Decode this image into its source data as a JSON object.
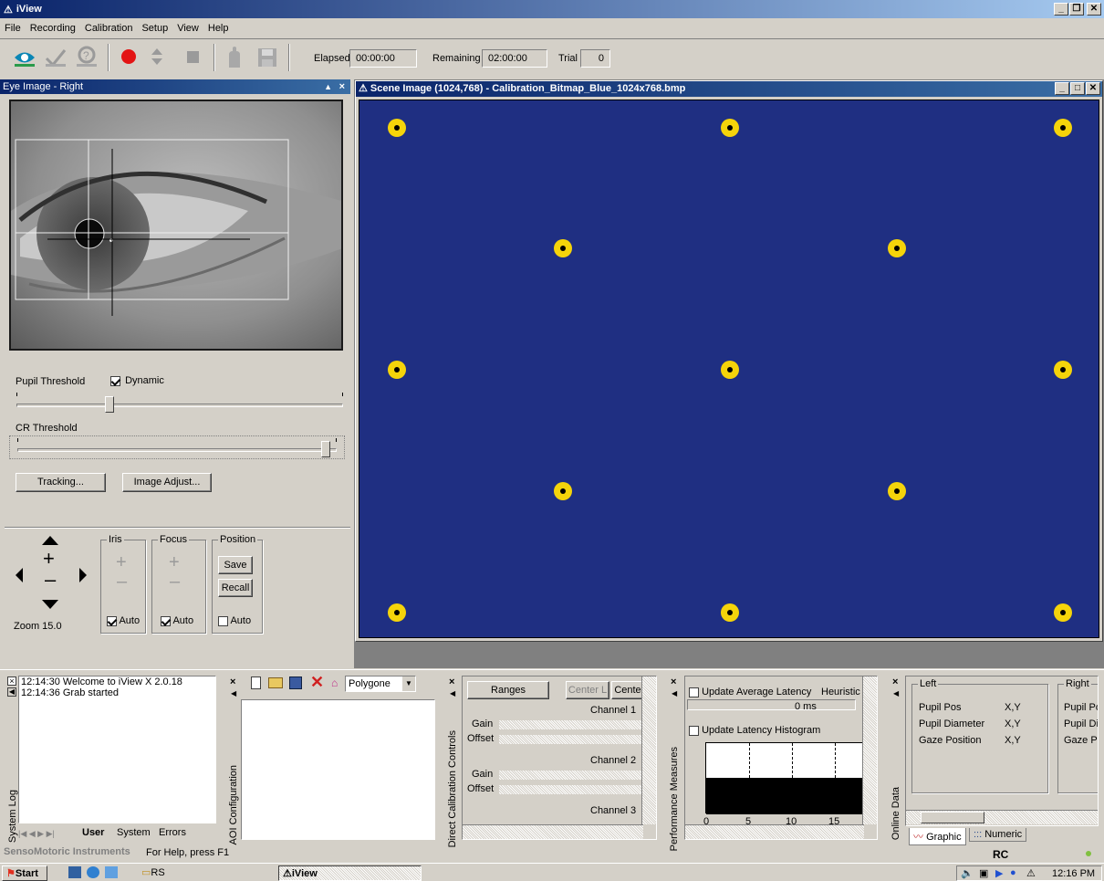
{
  "app": {
    "title": "iView"
  },
  "menu": [
    "File",
    "Recording",
    "Calibration",
    "Setup",
    "View",
    "Help"
  ],
  "toolbar": {
    "elapsed_label": "Elapsed",
    "elapsed_value": "00:00:00",
    "remaining_label": "Remaining",
    "remaining_value": "02:00:00",
    "trial_label": "Trial",
    "trial_value": "0"
  },
  "eye_panel": {
    "title": "Eye Image - Right",
    "pupil_threshold_label": "Pupil Threshold",
    "dynamic_label": "Dynamic",
    "dynamic_checked": true,
    "pupil_threshold_level": 0.28,
    "cr_threshold_label": "CR Threshold",
    "cr_threshold_level": 0.98,
    "tracking_button": "Tracking...",
    "image_adjust_button": "Image Adjust..."
  },
  "camera_controls": {
    "zoom": "Zoom 15.0",
    "iris_label": "Iris",
    "focus_label": "Focus",
    "position_label": "Position",
    "save_button": "Save",
    "recall_button": "Recall",
    "auto_label": "Auto",
    "iris_auto": true,
    "focus_auto": true,
    "position_auto": false
  },
  "scene": {
    "title": "Scene Image (1024,768) - Calibration_Bitmap_Blue_1024x768.bmp",
    "background": "#1f2f82",
    "dot_color": "#f5d40a"
  },
  "system_log": {
    "title": "System Log",
    "entries": [
      "12:14:30  Welcome to iView X 2.0.18",
      "12:14:36  Grab started"
    ],
    "tabs": [
      "User",
      "System",
      "Errors"
    ]
  },
  "aoi": {
    "title": "AOI Configuration",
    "shape_select": "Polygone"
  },
  "direct_calibration": {
    "title": "Direct Calibration Controls",
    "ranges_button": "Ranges",
    "center_l": "Center L",
    "center_r": "Cente",
    "channel_1": "Channel 1",
    "channel_2": "Channel 2",
    "channel_3": "Channel 3",
    "gain_label": "Gain",
    "offset_label": "Offset"
  },
  "performance": {
    "title": "Performance Measures",
    "update_avg_latency": "Update Average Latency",
    "heuristic": "Heuristic F",
    "latency_value": "0 ms",
    "update_latency_hist": "Update Latency Histogram",
    "axis_ticks": [
      "0",
      "5",
      "10",
      "15"
    ]
  },
  "online_data": {
    "title": "Online Data",
    "left_group": "Left",
    "right_group": "Right",
    "rows": [
      {
        "label": "Pupil Pos",
        "value": "X,Y",
        "right": "Pupil Po"
      },
      {
        "label": "Pupil Diameter",
        "value": "X,Y",
        "right": "Pupil Di"
      },
      {
        "label": "Gaze Position",
        "value": "X,Y",
        "right": "Gaze Po"
      }
    ],
    "tab_graphic": "Graphic",
    "tab_numeric": "Numeric",
    "rc": "RC"
  },
  "statusbar": {
    "company": "SensoMotoric Instruments",
    "help": "For Help, press F1"
  },
  "taskbar": {
    "start": "Start",
    "rs": "RS",
    "iview": "iView",
    "clock": "12:16 PM"
  }
}
